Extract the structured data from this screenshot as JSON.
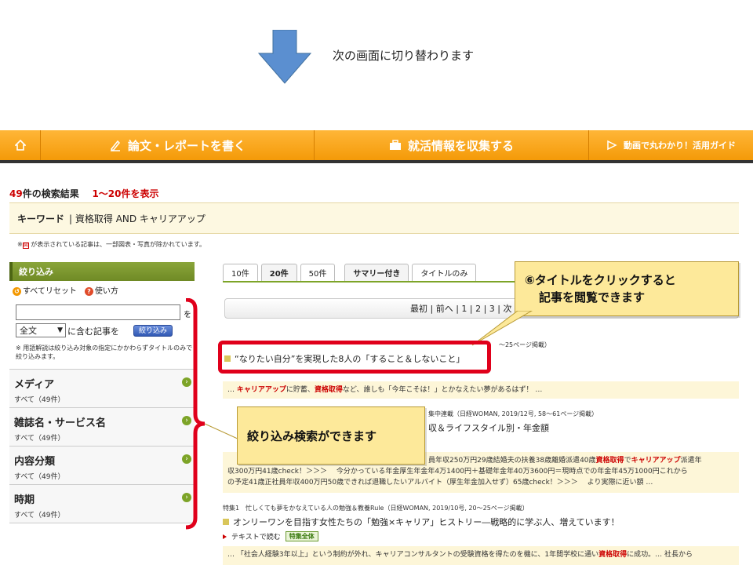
{
  "slide": {
    "caption": "次の画面に切り替わります"
  },
  "nav": {
    "home_icon": "home-icon",
    "items": [
      {
        "label": "論文・レポートを書く",
        "icon": "pen-icon"
      },
      {
        "label": "就活情報を収集する",
        "icon": "briefcase-icon"
      },
      {
        "label": "動画で丸わかり！活用ガイド",
        "icon": "video-icon"
      }
    ]
  },
  "results": {
    "count": "49",
    "count_suffix": "件の検索結果",
    "range": "1〜20件を表示",
    "keyword_label": "キーワード",
    "keyword_value": "| 資格取得 AND キャリアアップ",
    "notice": "が表示されている記事は、一部図表・写真が除かれています。"
  },
  "sidebar": {
    "title": "絞り込み",
    "reset": "すべてリセット",
    "howto": "使い方",
    "input_suffix": "を",
    "scope_value": "全文",
    "scope_text": "に含む記事を",
    "filter_button": "絞り込み",
    "note": "※ 用語解説は絞り込み対象の指定にかかわらずタイトルのみで絞り込みます。",
    "facets": [
      {
        "title": "メディア",
        "sub": "すべて（49件）"
      },
      {
        "title": "雑誌名・サービス名",
        "sub": "すべて（49件）"
      },
      {
        "title": "内容分類",
        "sub": "すべて（49件）"
      },
      {
        "title": "時期",
        "sub": "すべて（49件）"
      }
    ]
  },
  "tabs": [
    "10件",
    "20件",
    "50件",
    "サマリー付き",
    "タイトルのみ"
  ],
  "pager": "最初 | 前へ | 1 | 2 | 3 | 次",
  "articles": [
    {
      "meta": "〜25ページ掲載）",
      "title": "“なりたい自分”を実現した8人の「すること＆しないこと」",
      "snippet_parts": [
        "… ",
        "キャリアアップ",
        "に貯蓄、",
        "資格取得",
        "など、誰しも「今年こそは！」とかなえたい夢があるはず！ …"
      ]
    },
    {
      "meta": "集中連載（日経WOMAN, 2019/12号, 58〜61ページ掲載）",
      "title": "収＆ライフスタイル別・年金額",
      "snippet_line1_parts": [
        "員年収250万円29歳結婚夫の扶養38歳離婚派遣40歳",
        "資格取得",
        "で",
        "キャリアアップ",
        "派遣年"
      ],
      "snippet_line2": "収300万円41歳check！＞＞＞　 今分かっている年金厚生年金年4万1400円＋基礎年金年40万3600円＝現時点での年金年45万1000円これから",
      "snippet_line3": "の予定41歳正社員年収400万円50歳できれば退職したいアルバイト（厚生年金加入せず）65歳check！＞＞＞　 より実際に近い額 …"
    },
    {
      "meta": "特集1　忙しくても夢をかなえている人の勉強＆教養Rule（日経WOMAN, 2019/10号, 20〜25ページ掲載）",
      "title": "オンリーワンを目指す女性たちの「勉強×キャリア」ヒストリー―戦略的に学ぶ人、増えています！",
      "read": "テキストで読む",
      "badge": "特集全体",
      "snippet_parts": [
        "… 「社会人経験3年以上」という制約が外れ、キャリアコンサルタントの受験資格を得たのを機に、1年間学校に通い",
        "資格取得",
        "に成功。… 社長から"
      ]
    }
  ],
  "callouts": {
    "title_click_line1": "⑥タイトルをクリックすると",
    "title_click_line2": "記事を閲覧できます",
    "filter": "絞り込み検索ができます"
  },
  "colors": {
    "nav_orange": "#f49a08",
    "accent_red": "#cc0000",
    "highlight_box": "#e0001b",
    "callout_yellow": "#fde99a",
    "arrow_blue": "#5b8fd0"
  }
}
